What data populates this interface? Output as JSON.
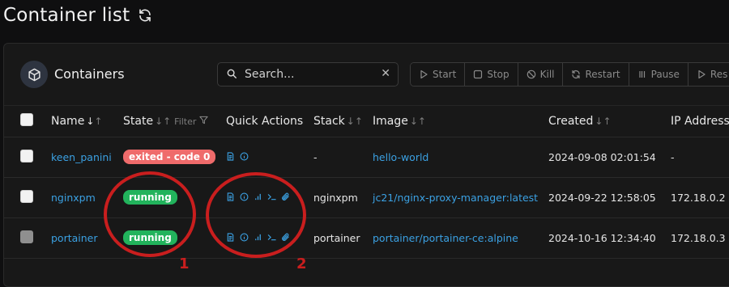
{
  "page": {
    "title": "Container list"
  },
  "panel": {
    "title": "Containers",
    "search": {
      "placeholder": "Search...",
      "value": ""
    },
    "actions": [
      "Start",
      "Stop",
      "Kill",
      "Restart",
      "Pause",
      "Res"
    ]
  },
  "table": {
    "columns": {
      "name": "Name",
      "state": "State",
      "filter": "Filter",
      "quick_actions": "Quick Actions",
      "stack": "Stack",
      "image": "Image",
      "created": "Created",
      "ip": "IP Address"
    },
    "rows": [
      {
        "name": "keen_panini",
        "state": "exited - code 0",
        "state_kind": "exited",
        "stack": "-",
        "image": "hello-world",
        "created": "2024-09-08 02:01:54",
        "ip": "-",
        "checkbox": "white",
        "quick_actions": [
          "logs-icon",
          "inspect-icon"
        ]
      },
      {
        "name": "nginxpm",
        "state": "running",
        "state_kind": "running",
        "stack": "nginxpm",
        "image": "jc21/nginx-proxy-manager:latest",
        "created": "2024-09-22 12:58:05",
        "ip": "172.18.0.2",
        "checkbox": "white",
        "quick_actions": [
          "logs-icon",
          "inspect-icon",
          "stats-icon",
          "console-icon",
          "attach-icon"
        ]
      },
      {
        "name": "portainer",
        "state": "running",
        "state_kind": "running",
        "stack": "portainer",
        "image": "portainer/portainer-ce:alpine",
        "created": "2024-10-16 12:34:40",
        "ip": "172.18.0.3",
        "checkbox": "grey",
        "quick_actions": [
          "logs-icon",
          "inspect-icon",
          "stats-icon",
          "console-icon",
          "attach-icon"
        ]
      }
    ]
  },
  "annotations": {
    "label_1": "1",
    "label_2": "2",
    "color": "#c91e1e"
  },
  "colors": {
    "link": "#3ba1e3",
    "running": "#22b35c",
    "exited": "#ef6b6b",
    "background": "#0f0f10",
    "panel": "#181818"
  }
}
